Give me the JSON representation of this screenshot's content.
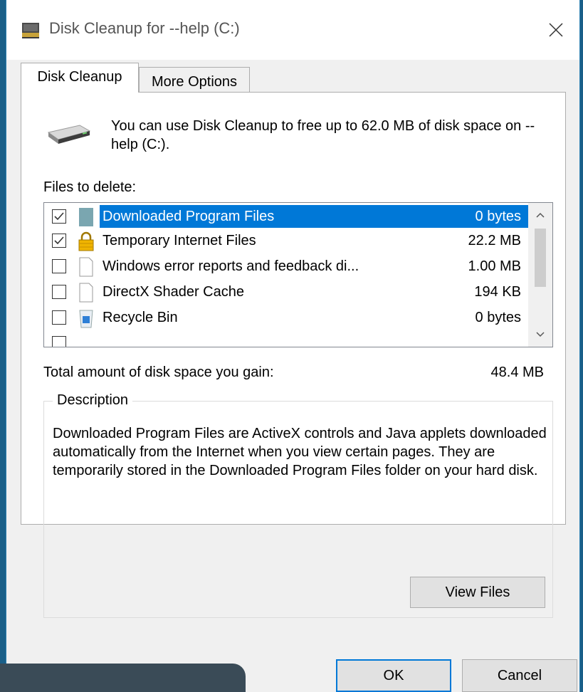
{
  "window": {
    "title": "Disk Cleanup for --help (C:)",
    "close_icon": "close-icon"
  },
  "tabs": [
    {
      "label": "Disk Cleanup",
      "active": true
    },
    {
      "label": "More Options",
      "active": false
    }
  ],
  "intro_text": "You can use Disk Cleanup to free up to 62.0 MB of disk space on --help (C:).",
  "files_label": "Files to delete:",
  "files": [
    {
      "name": "Downloaded Program Files",
      "size": "0 bytes",
      "checked": true,
      "selected": true,
      "icon": "folder-icon"
    },
    {
      "name": "Temporary Internet Files",
      "size": "22.2 MB",
      "checked": true,
      "selected": false,
      "icon": "lock-icon"
    },
    {
      "name": "Windows error reports and feedback di...",
      "size": "1.00 MB",
      "checked": false,
      "selected": false,
      "icon": "document-icon"
    },
    {
      "name": "DirectX Shader Cache",
      "size": "194 KB",
      "checked": false,
      "selected": false,
      "icon": "document-icon"
    },
    {
      "name": "Recycle Bin",
      "size": "0 bytes",
      "checked": false,
      "selected": false,
      "icon": "recycle-bin-icon"
    }
  ],
  "total": {
    "label": "Total amount of disk space you gain:",
    "value": "48.4 MB"
  },
  "description": {
    "legend": "Description",
    "text": "Downloaded Program Files are ActiveX controls and Java applets downloaded automatically from the Internet when you view certain pages. They are temporarily stored in the Downloaded Program Files folder on your hard disk."
  },
  "buttons": {
    "view_files": "View Files",
    "ok": "OK",
    "cancel": "Cancel"
  },
  "colors": {
    "selection": "#0078d7",
    "window_border": "#2a7fb1"
  }
}
